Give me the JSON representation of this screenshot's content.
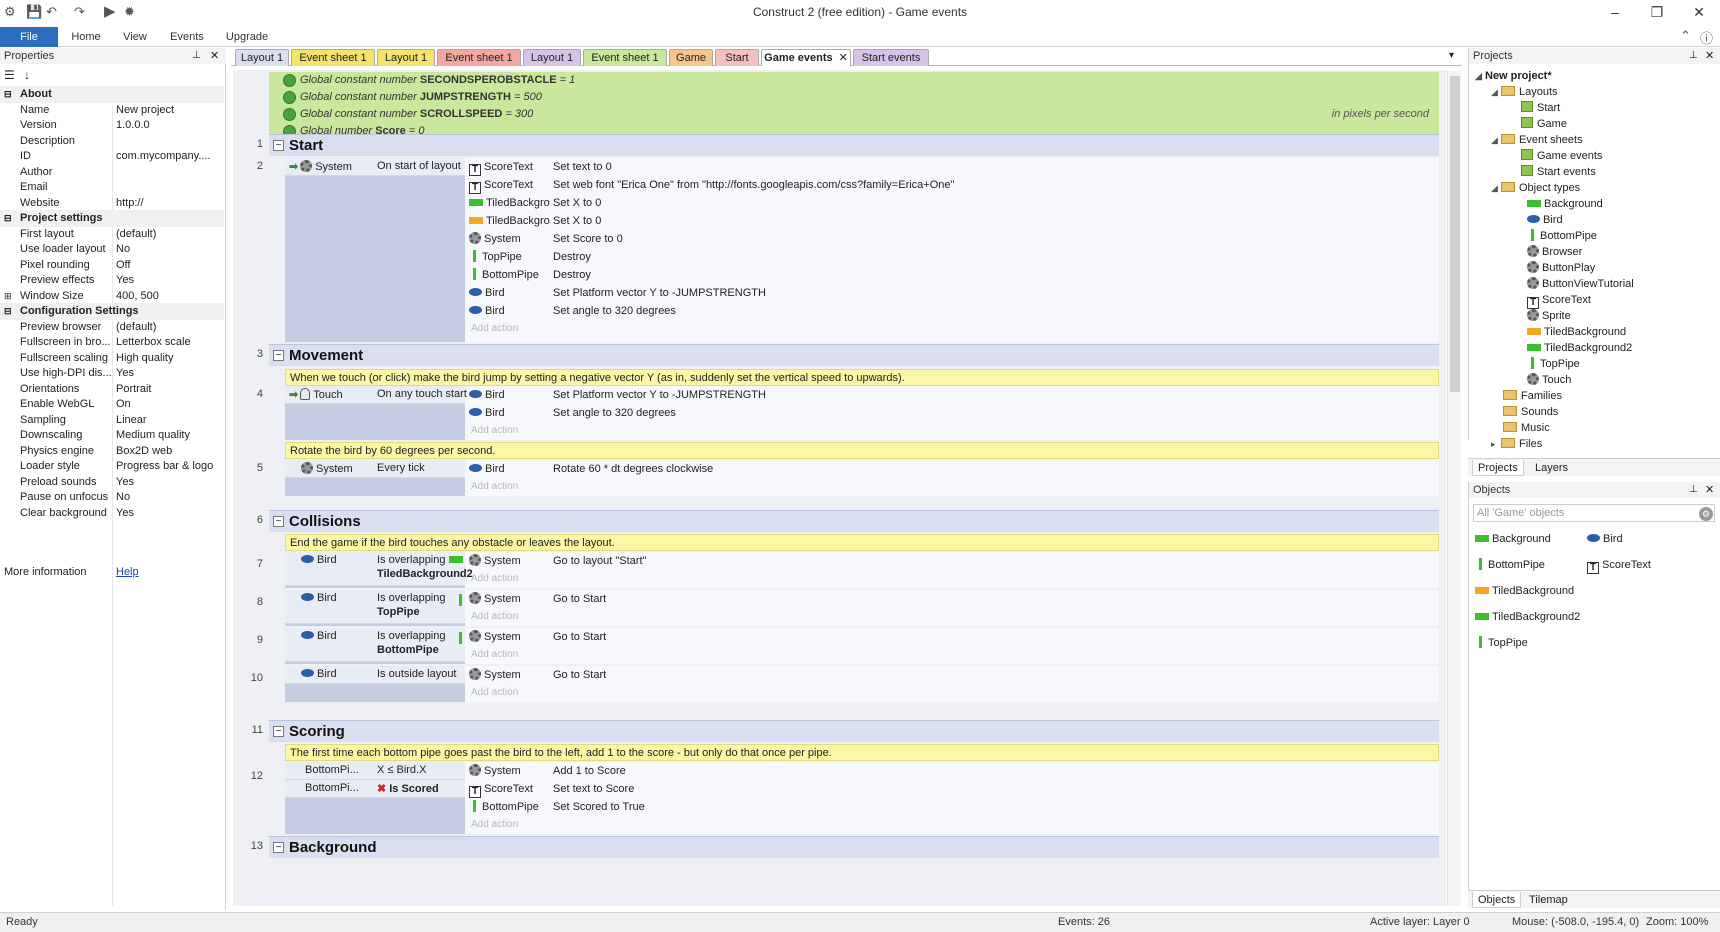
{
  "window": {
    "title": "Construct 2 (free edition) - Game events"
  },
  "ribbon": {
    "tabs": [
      "File",
      "Home",
      "View",
      "Events",
      "Upgrade"
    ]
  },
  "properties": {
    "title": "Properties",
    "rows": [
      {
        "cat": true,
        "k": "About"
      },
      {
        "k": "Name",
        "v": "New project"
      },
      {
        "k": "Version",
        "v": "1.0.0.0"
      },
      {
        "k": "Description",
        "v": ""
      },
      {
        "k": "ID",
        "v": "com.mycompany...."
      },
      {
        "k": "Author",
        "v": ""
      },
      {
        "k": "Email",
        "v": ""
      },
      {
        "k": "Website",
        "v": "http://"
      },
      {
        "cat": true,
        "k": "Project settings"
      },
      {
        "k": "First layout",
        "v": "(default)"
      },
      {
        "k": "Use loader layout",
        "v": "No"
      },
      {
        "k": "Pixel rounding",
        "v": "Off"
      },
      {
        "k": "Preview effects",
        "v": "Yes"
      },
      {
        "k": "Window Size",
        "v": "400, 500"
      },
      {
        "cat": true,
        "k": "Configuration Settings"
      },
      {
        "k": "Preview browser",
        "v": "(default)"
      },
      {
        "k": "Fullscreen in bro...",
        "v": "Letterbox scale"
      },
      {
        "k": "Fullscreen scaling",
        "v": "High quality"
      },
      {
        "k": "Use high-DPI dis...",
        "v": "Yes"
      },
      {
        "k": "Orientations",
        "v": "Portrait"
      },
      {
        "k": "Enable WebGL",
        "v": "On"
      },
      {
        "k": "Sampling",
        "v": "Linear"
      },
      {
        "k": "Downscaling",
        "v": "Medium quality"
      },
      {
        "k": "Physics engine",
        "v": "Box2D web"
      },
      {
        "k": "Loader style",
        "v": "Progress bar & logo"
      },
      {
        "k": "Preload sounds",
        "v": "Yes"
      },
      {
        "k": "Pause on unfocus",
        "v": "No"
      },
      {
        "k": "Clear background",
        "v": "Yes"
      }
    ],
    "more_info_label": "More information",
    "help_link": "Help"
  },
  "doc_tabs": [
    {
      "label": "Layout 1",
      "color": "#d9dff0"
    },
    {
      "label": "Event sheet 1",
      "color": "#f6e36a"
    },
    {
      "label": "Layout 1",
      "color": "#f6e36a"
    },
    {
      "label": "Event sheet 1",
      "color": "#f4a6a0"
    },
    {
      "label": "Layout 1",
      "color": "#d7c2ea"
    },
    {
      "label": "Event sheet 1",
      "color": "#c9e89b"
    },
    {
      "label": "Game",
      "color": "#f7c58c"
    },
    {
      "label": "Start",
      "color": "#f5c0c0"
    },
    {
      "label": "Game events",
      "color": "#ffffff"
    },
    {
      "label": "Start events",
      "color": "#d7c2ea"
    }
  ],
  "globals": [
    {
      "prefix": "Global constant number",
      "name": "SECONDSPEROBSTACLE",
      "value": "= 1",
      "comment": ""
    },
    {
      "prefix": "Global constant number",
      "name": "JUMPSTRENGTH",
      "value": "= 500",
      "comment": ""
    },
    {
      "prefix": "Global constant number",
      "name": "SCROLLSPEED",
      "value": "= 300",
      "comment": "in pixels per second"
    },
    {
      "prefix": "Global number",
      "name": "Score",
      "value": "= 0",
      "comment": ""
    }
  ],
  "events": {
    "g1": {
      "num": "1",
      "title": "Start"
    },
    "e2": {
      "num": "2",
      "cond_obj": "System",
      "cond": "On start of layout",
      "actions": [
        {
          "obj": "ScoreText",
          "icon": "t",
          "text": "Set text to 0"
        },
        {
          "obj": "ScoreText",
          "icon": "t",
          "text": "Set web font \"Erica One\" from \"http://fonts.googleapis.com/css?family=Erica+One\""
        },
        {
          "obj": "TiledBackgro...",
          "icon": "tiled",
          "text": "Set X to 0"
        },
        {
          "obj": "TiledBackgro...",
          "icon": "tiled2",
          "text": "Set X to 0"
        },
        {
          "obj": "System",
          "icon": "gear",
          "text": "Set Score to 0"
        },
        {
          "obj": "TopPipe",
          "icon": "pipe",
          "text": "Destroy"
        },
        {
          "obj": "BottomPipe",
          "icon": "pipe",
          "text": "Destroy"
        },
        {
          "obj": "Bird",
          "icon": "bird",
          "text": "Set Platform vector Y to -JUMPSTRENGTH"
        },
        {
          "obj": "Bird",
          "icon": "bird",
          "text": "Set angle to 320 degrees"
        }
      ]
    },
    "g3": {
      "num": "3",
      "title": "Movement"
    },
    "c3": "When we touch (or click) make the bird jump by setting a negative vector Y (as in, suddenly set the vertical speed to upwards).",
    "e4": {
      "num": "4",
      "cond_obj": "Touch",
      "cond": "On any touch start",
      "actions": [
        {
          "obj": "Bird",
          "icon": "bird",
          "text": "Set Platform vector Y to -JUMPSTRENGTH"
        },
        {
          "obj": "Bird",
          "icon": "bird",
          "text": "Set angle to 320 degrees"
        }
      ]
    },
    "c4": "Rotate the bird by 60 degrees per second.",
    "e5": {
      "num": "5",
      "cond_obj": "System",
      "cond": "Every tick",
      "actions": [
        {
          "obj": "Bird",
          "icon": "bird",
          "text": "Rotate 60 * dt  degrees clockwise"
        }
      ]
    },
    "g6": {
      "num": "6",
      "title": "Collisions"
    },
    "c6": "End the game if the bird touches any obstacle or leaves the layout.",
    "e7": {
      "num": "7",
      "cond_obj": "Bird",
      "cond": "Is overlapping",
      "cond2": "TiledBackground2",
      "act_obj": "System",
      "act": "Go to layout \"Start\""
    },
    "e8": {
      "num": "8",
      "cond_obj": "Bird",
      "cond": "Is overlapping",
      "cond2": "TopPipe",
      "act_obj": "System",
      "act": "Go to Start"
    },
    "e9": {
      "num": "9",
      "cond_obj": "Bird",
      "cond": "Is overlapping",
      "cond2": "BottomPipe",
      "act_obj": "System",
      "act": "Go to Start"
    },
    "e10": {
      "num": "10",
      "cond_obj": "Bird",
      "cond": "Is outside layout",
      "act_obj": "System",
      "act": "Go to Start"
    },
    "g11": {
      "num": "11",
      "title": "Scoring"
    },
    "c11": "The first time each bottom pipe goes past the bird to the left, add 1 to the score - but only do that once per pipe.",
    "e12": {
      "num": "12",
      "cond1_obj": "BottomPi...",
      "cond1": "X ≤ Bird.X",
      "cond2_obj": "BottomPi...",
      "cond2": "Is Scored",
      "actions": [
        {
          "obj": "System",
          "icon": "gear",
          "text": "Add 1 to Score"
        },
        {
          "obj": "ScoreText",
          "icon": "t",
          "text": "Set text to Score"
        },
        {
          "obj": "BottomPipe",
          "icon": "pipe",
          "text": "Set Scored to True"
        }
      ]
    },
    "g13": {
      "num": "13",
      "title": "Background"
    },
    "add_action": "Add action"
  },
  "projects": {
    "title": "Projects",
    "root": "New project*",
    "layouts_label": "Layouts",
    "layouts": [
      "Start",
      "Game"
    ],
    "sheets_label": "Event sheets",
    "sheets": [
      "Game events",
      "Start events"
    ],
    "types_label": "Object types",
    "types": [
      "Background",
      "Bird",
      "BottomPipe",
      "Browser",
      "ButtonPlay",
      "ButtonViewTutorial",
      "ScoreText",
      "Sprite",
      "TiledBackground",
      "TiledBackground2",
      "TopPipe",
      "Touch"
    ],
    "families": "Families",
    "sounds": "Sounds",
    "music": "Music",
    "files": "Files",
    "tabs": [
      "Projects",
      "Layers"
    ]
  },
  "objects": {
    "title": "Objects",
    "search_placeholder": "All 'Game' objects",
    "items": [
      "Background",
      "Bird",
      "BottomPipe",
      "ScoreText",
      "TiledBackground",
      "TiledBackground2",
      "TopPipe"
    ],
    "tabs": [
      "Objects",
      "Tilemap"
    ]
  },
  "status": {
    "ready": "Ready",
    "events": "Events: 26",
    "layer": "Active layer: Layer 0",
    "mouse": "Mouse: (-508.0, -195.4, 0)",
    "zoom": "Zoom: 100%"
  }
}
